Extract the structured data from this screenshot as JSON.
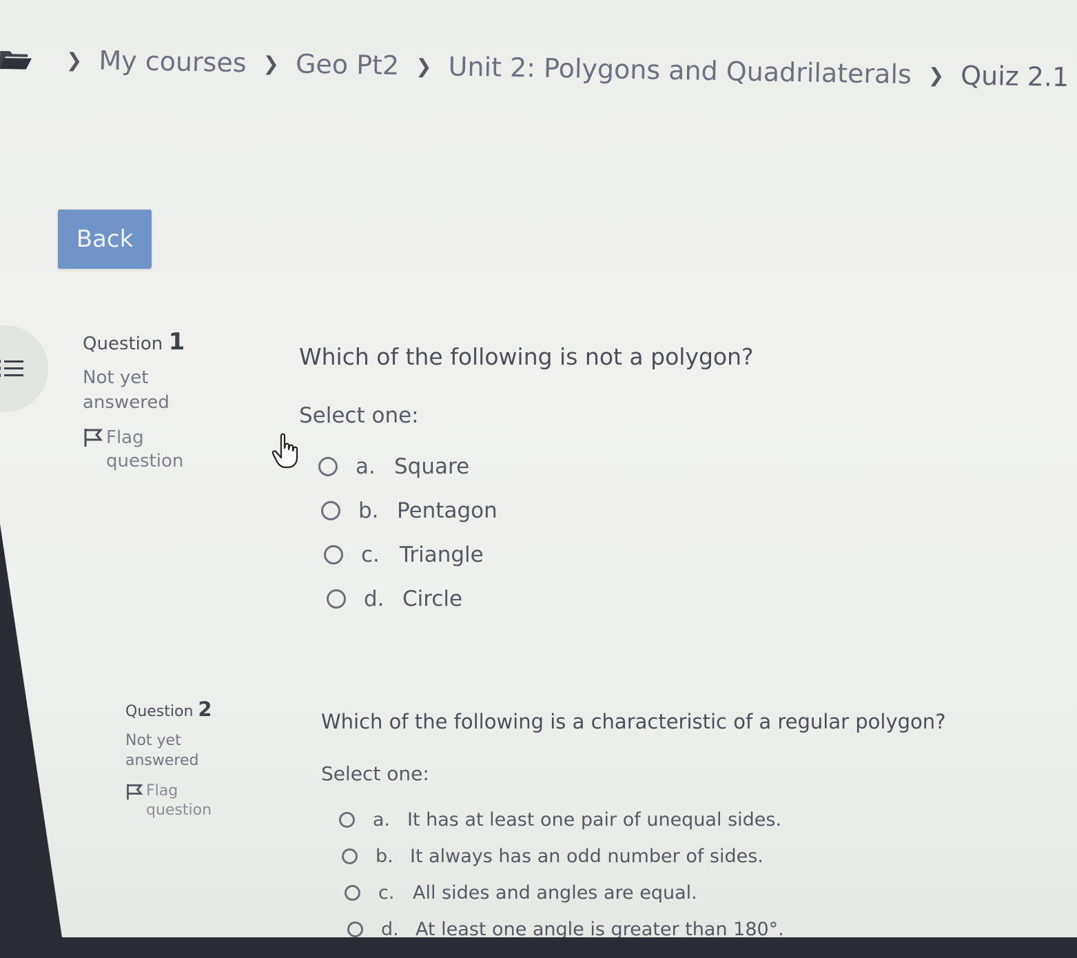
{
  "breadcrumb": {
    "items": [
      {
        "label": "My courses"
      },
      {
        "label": "Geo Pt2"
      },
      {
        "label": "Unit 2: Polygons and Quadrilaterals"
      },
      {
        "label": "Quiz 2.1"
      }
    ]
  },
  "back_button": {
    "label": "Back"
  },
  "questions": [
    {
      "label": "Question",
      "number": "1",
      "state": "Not yet answered",
      "flag_label": "Flag question",
      "text": "Which of the following is not a polygon?",
      "select_prompt": "Select one:",
      "options": [
        {
          "letter": "a.",
          "text": "Square"
        },
        {
          "letter": "b.",
          "text": "Pentagon"
        },
        {
          "letter": "c.",
          "text": "Triangle"
        },
        {
          "letter": "d.",
          "text": "Circle"
        }
      ]
    },
    {
      "label": "Question",
      "number": "2",
      "state": "Not yet answered",
      "flag_label": "Flag question",
      "text": "Which of the following is a characteristic of a regular polygon?",
      "select_prompt": "Select one:",
      "options": [
        {
          "letter": "a.",
          "text": "It has at least one pair of unequal sides."
        },
        {
          "letter": "b.",
          "text": "It always has an odd number of sides."
        },
        {
          "letter": "c.",
          "text": "All sides and angles are equal."
        },
        {
          "letter": "d.",
          "text": "At least one angle is greater than 180°."
        }
      ]
    }
  ],
  "icons": {
    "folder": "folder-icon",
    "chevron": "chevron-right-icon",
    "drawer": "list-icon",
    "flag": "flag-icon",
    "cursor": "hand-pointer-icon"
  },
  "colors": {
    "back_button": "#6f94c7",
    "page_background": "#eef0ed"
  }
}
